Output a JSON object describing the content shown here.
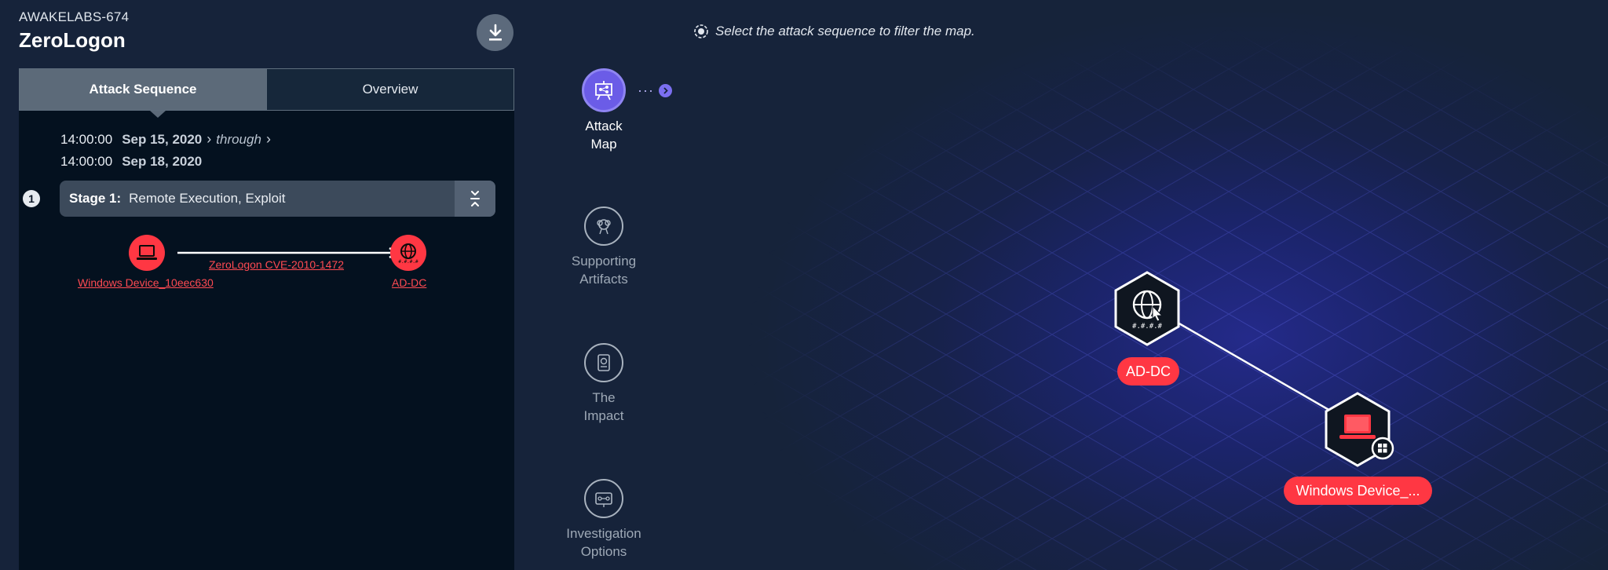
{
  "header": {
    "case_id": "AWAKELABS-674",
    "title": "ZeroLogon"
  },
  "tabs": [
    {
      "label": "Attack Sequence",
      "active": true
    },
    {
      "label": "Overview",
      "active": false
    }
  ],
  "timeline": {
    "start_time": "14:00:00",
    "start_date": "Sep 15, 2020",
    "through_label": "through",
    "end_time": "14:00:00",
    "end_date": "Sep 18, 2020"
  },
  "stage": {
    "number": "1",
    "label": "Stage 1:",
    "description": "Remote Execution, Exploit"
  },
  "sequence": {
    "source_label": "Windows Device_10eec630",
    "edge_label": "ZeroLogon CVE-2010-1472",
    "target_label": "AD-DC"
  },
  "rail": {
    "items": [
      {
        "label": "Attack Map",
        "icon": "attack-map-icon",
        "active": true
      },
      {
        "label": "Supporting Artifacts",
        "icon": "artifacts-icon",
        "active": false
      },
      {
        "label": "The Impact",
        "icon": "impact-icon",
        "active": false
      },
      {
        "label": "Investigation Options",
        "icon": "investigation-icon",
        "active": false
      }
    ]
  },
  "map": {
    "hint": "Select the attack sequence to filter the map.",
    "nodes": [
      {
        "label": "AD-DC",
        "icon": "globe-cursor-icon"
      },
      {
        "label": "Windows Device_...",
        "icon": "laptop-icon",
        "os_badge": "windows-icon"
      }
    ]
  },
  "colors": {
    "accent_red": "#ff3743",
    "accent_purple": "#6b5ce7",
    "panel_bg": "#04111f",
    "page_bg": "#16233a"
  }
}
